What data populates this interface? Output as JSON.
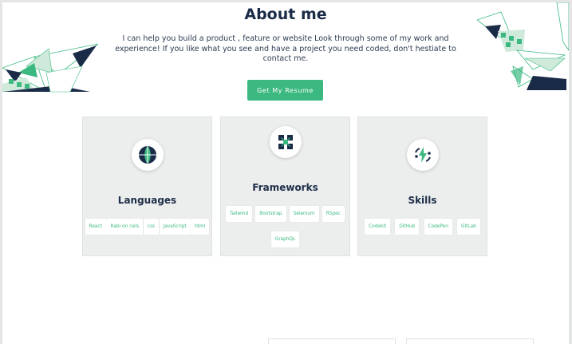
{
  "about": {
    "title": "About me",
    "intro": "I can help you build a product , feature or website Look through some of my work and experience! If you like what you see and have a project you need coded, don't hestiate to contact me.",
    "resume_button": "Get My Resume"
  },
  "icons": {
    "languages": "globe-icon",
    "frameworks": "cubes-icon",
    "skills": "bolt-gear-icon"
  },
  "colors": {
    "accent": "#3bb980",
    "heading": "#1a2b48",
    "card_bg": "#eceeee",
    "deco_dark": "#1a2b48"
  },
  "cards": [
    {
      "title": "Languages",
      "tags": [
        "React",
        "Rabi on rails",
        "css",
        "JavaScript",
        "html"
      ]
    },
    {
      "title": "Frameworks",
      "tags": [
        "Tailwind",
        "Bootstrap",
        "Selenium",
        "RSpec",
        "GraphQL"
      ]
    },
    {
      "title": "Skills",
      "tags": [
        "Codekit",
        "GitHub",
        "CodePen",
        "GitLab"
      ]
    }
  ]
}
